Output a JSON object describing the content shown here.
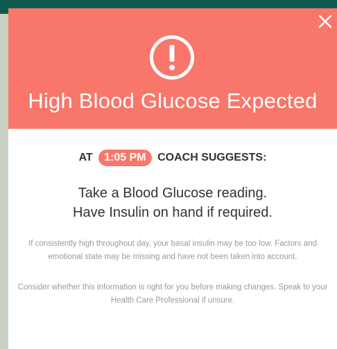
{
  "modal": {
    "title": "High Blood Glucose Expected",
    "close_icon": "close-icon",
    "alert_icon": "exclamation-circle-icon",
    "header_color": "#f8776a"
  },
  "suggestion": {
    "prefix": "AT",
    "time": "1:05 PM",
    "suffix": "COACH SUGGESTS:",
    "lines": [
      "Take a Blood Glucose reading.",
      "Have Insulin on hand if required."
    ]
  },
  "notes": {
    "insulin_note": "If consistently high throughout day, your basal insulin may be too low. Factors and emotional state may be missing and have not been taken into account.",
    "disclaimer": "Consider whether this information is right for you before making changes. Speak to your Health Care Professional if unsure."
  }
}
